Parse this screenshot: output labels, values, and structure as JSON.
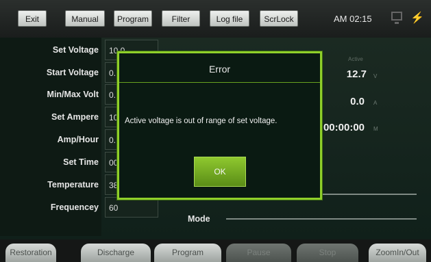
{
  "toolbar": {
    "buttons": [
      "Exit",
      "Manual",
      "Program",
      "Filter",
      "Log file",
      "ScrLock"
    ],
    "clock": "AM 02:15",
    "icons": [
      "monitor-icon",
      "usb-icon"
    ]
  },
  "settings": [
    {
      "label": "Set Voltage",
      "value": "10.0"
    },
    {
      "label": "Start Voltage",
      "value": "0."
    },
    {
      "label": "Min/Max Volt",
      "value": "0."
    },
    {
      "label": "Set Ampere",
      "value": "10"
    },
    {
      "label": "Amp/Hour",
      "value": "0."
    },
    {
      "label": "Set Time",
      "value": "00"
    },
    {
      "label": "Temperature",
      "value": "38"
    },
    {
      "label": "Frequencey",
      "value": "60"
    }
  ],
  "active": {
    "header": "Active",
    "voltage": "12.7",
    "voltage_unit": "V",
    "current": "0.0",
    "current_unit": "A",
    "time": "00:00:00",
    "time_unit": "M"
  },
  "mode_label": "Mode",
  "bottom_tabs": [
    {
      "label": "Restoration",
      "enabled": true
    },
    {
      "label": "Discharge",
      "enabled": true
    },
    {
      "label": "Program",
      "enabled": true
    },
    {
      "label": "Pause",
      "enabled": false
    },
    {
      "label": "Stop",
      "enabled": false
    },
    {
      "label": "ZoomIn/Out",
      "enabled": true
    }
  ],
  "dialog": {
    "title": "Error",
    "message": "Active voltage is out of range of set voltage.",
    "ok_label": "OK"
  },
  "colors": {
    "accent": "#8fcf2a",
    "background": "#10201a"
  }
}
